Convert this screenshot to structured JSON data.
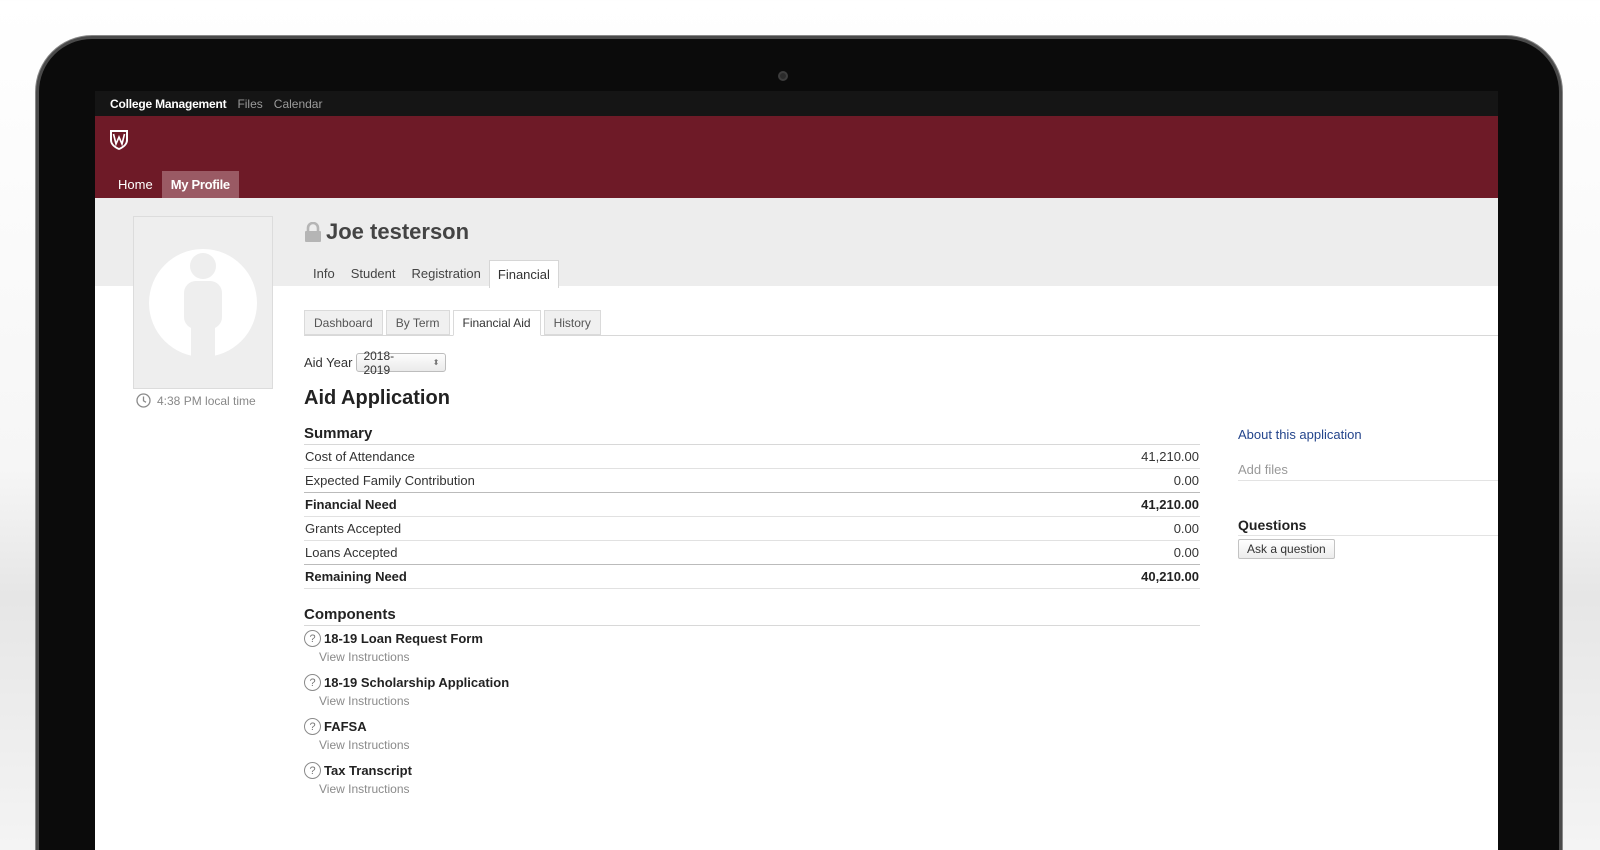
{
  "topbar": {
    "brand": "College Management",
    "links": [
      "Files",
      "Calendar"
    ]
  },
  "header": {
    "logo_icon": "crest-shield-icon",
    "nav": [
      {
        "label": "Home",
        "active": false
      },
      {
        "label": "My Profile",
        "active": true
      }
    ]
  },
  "profile": {
    "name": "Joe testerson",
    "lock_icon": "lock-icon",
    "local_time": "4:38 PM local time",
    "tabs": [
      {
        "label": "Info",
        "active": false
      },
      {
        "label": "Student",
        "active": false
      },
      {
        "label": "Registration",
        "active": false
      },
      {
        "label": "Financial",
        "active": true
      }
    ]
  },
  "financial": {
    "subtabs": [
      {
        "label": "Dashboard",
        "active": false
      },
      {
        "label": "By Term",
        "active": false
      },
      {
        "label": "Financial Aid",
        "active": true
      },
      {
        "label": "History",
        "active": false
      }
    ],
    "aid_year_label": "Aid Year",
    "aid_year_value": "2018-2019",
    "title": "Aid Application",
    "summary_heading": "Summary",
    "summary": [
      {
        "label": "Cost of Attendance",
        "value": "41,210.00",
        "bold": false
      },
      {
        "label": "Expected Family Contribution",
        "value": "0.00",
        "bold": false
      },
      {
        "label": "Financial Need",
        "value": "41,210.00",
        "bold": true
      },
      {
        "label": "Grants Accepted",
        "value": "0.00",
        "bold": false
      },
      {
        "label": "Loans Accepted",
        "value": "0.00",
        "bold": false
      },
      {
        "label": "Remaining Need",
        "value": "40,210.00",
        "bold": true
      }
    ],
    "components_heading": "Components",
    "components": [
      {
        "title": "18-19 Loan Request Form",
        "link": "View Instructions"
      },
      {
        "title": "18-19 Scholarship Application",
        "link": "View Instructions"
      },
      {
        "title": "FAFSA",
        "link": "View Instructions"
      },
      {
        "title": "Tax Transcript",
        "link": "View Instructions"
      }
    ]
  },
  "sidebar": {
    "about_link": "About this application",
    "add_files": "Add files",
    "questions_heading": "Questions",
    "ask_button": "Ask a question"
  },
  "colors": {
    "header_bg": "#6e1a27",
    "active_nav": "#9a5a64",
    "link": "#24458c"
  }
}
